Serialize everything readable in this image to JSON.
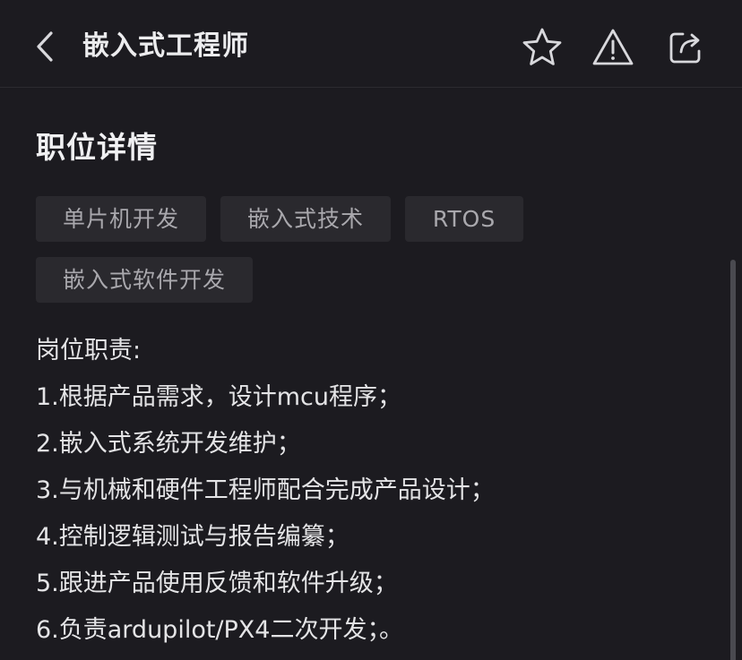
{
  "header": {
    "title": "嵌入式工程师"
  },
  "section": {
    "title": "职位详情"
  },
  "tags": [
    "单片机开发",
    "嵌入式技术",
    "RTOS",
    "嵌入式软件开发"
  ],
  "description": {
    "heading": "岗位职责:",
    "lines": [
      "1.根据产品需求，设计mcu程序；",
      "2.嵌入式系统开发维护；",
      "3.与机械和硬件工程师配合完成产品设计；",
      "4.控制逻辑测试与报告编纂；",
      "5.跟进产品使用反馈和软件升级；",
      "6.负责ardupilot/PX4二次开发；。"
    ]
  },
  "icons": {
    "back": "chevron-left-icon",
    "favorite": "star-icon",
    "report": "warning-icon",
    "share": "share-icon"
  }
}
